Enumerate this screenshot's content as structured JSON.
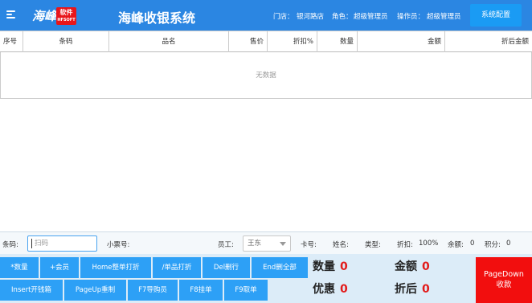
{
  "header": {
    "logo_text": "海峰",
    "logo_badge_top": "软件",
    "logo_badge_bottom": "HFSOFT",
    "title": "海峰收银系统",
    "store_label": "门店：",
    "store_value": "银河路店",
    "role_label": "角色：",
    "role_value": "超级管理员",
    "operator_label": "操作员：",
    "operator_value": "超级管理员",
    "config_button": "系统配置"
  },
  "table": {
    "columns": [
      "序号",
      "条码",
      "品名",
      "售价",
      "折扣%",
      "数量",
      "金额",
      "折后金额"
    ],
    "empty_text": "无数据",
    "rows": []
  },
  "scanbar": {
    "barcode_label": "条码:",
    "barcode_placeholder": "扫码",
    "ticket_label": "小票号:",
    "ticket_value": "",
    "employee_label": "员工:",
    "employee_value": "王东",
    "card_label": "卡号:",
    "name_label": "姓名:",
    "type_label": "类型:",
    "discount_label": "折扣:",
    "discount_value": "100%",
    "balance_label": "余额:",
    "balance_value": "0",
    "points_label": "积分:",
    "points_value": "0"
  },
  "function_keys": {
    "row1": [
      "*数量",
      "+会员",
      "Home整单打折",
      "/单品打折",
      "Del删行",
      "End删全部"
    ],
    "row2": [
      "Insert开钱箱",
      "PageUp重制",
      "F7导购员",
      "F8挂单",
      "F9取单"
    ]
  },
  "summary": {
    "qty_label": "数量",
    "qty_value": "0",
    "amount_label": "金额",
    "amount_value": "0",
    "discount_label": "优惠",
    "discount_value": "0",
    "after_label": "折后",
    "after_value": "0"
  },
  "pay_button": {
    "line1": "PageDown",
    "line2": "收款"
  },
  "colors": {
    "header_bg": "#2b86e2",
    "fkey_bg": "#2da0f6",
    "pay_bg": "#f20e0e",
    "number_red": "#e21b1b"
  }
}
